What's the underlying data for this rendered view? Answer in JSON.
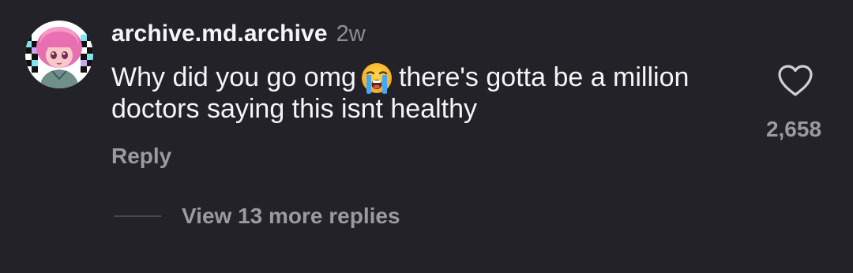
{
  "comment": {
    "avatar_icon": "anime-avatar-icon",
    "username": "archive.md.archive",
    "timestamp": "2w",
    "text_before_emoji": "Why did you go omg",
    "emoji": "loudly-crying-face-emoji",
    "text_after_emoji": "there's gotta be a million doctors saying this isnt healthy",
    "reply_label": "Reply",
    "like_icon": "heart-icon",
    "like_count": "2,658",
    "view_replies_label": "View 13 more replies"
  },
  "colors": {
    "background": "#222228",
    "primary_text": "#f5f5f5",
    "secondary_text": "#9a9aa0",
    "avatar_accent_pink": "#e86fb0",
    "avatar_accent_cyan": "#7fe3f0"
  }
}
